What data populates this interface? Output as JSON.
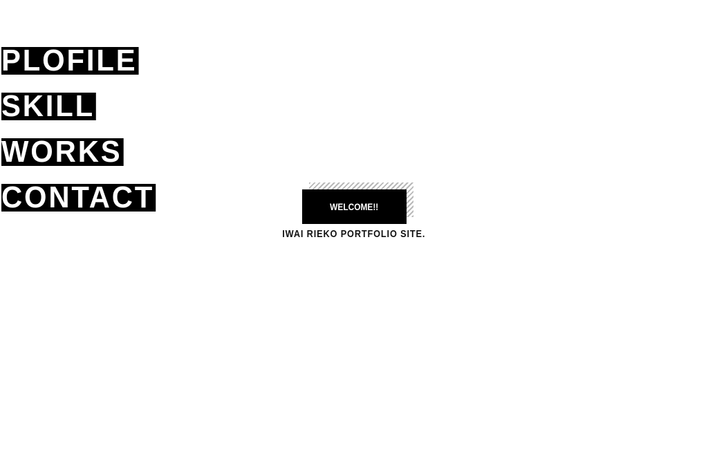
{
  "nav": {
    "items": [
      {
        "label": "PLOFILE"
      },
      {
        "label": "SKILL"
      },
      {
        "label": "WORKS"
      },
      {
        "label": "CONTACT"
      }
    ]
  },
  "hero": {
    "welcome": "WELCOME!!",
    "subtitle": "IWAI RIEKO PORTFOLIO SITE."
  },
  "colors": {
    "background": "#ffffff",
    "block": "#000000",
    "text_inverse": "#ffffff",
    "stripe": "#b9b9b9"
  }
}
